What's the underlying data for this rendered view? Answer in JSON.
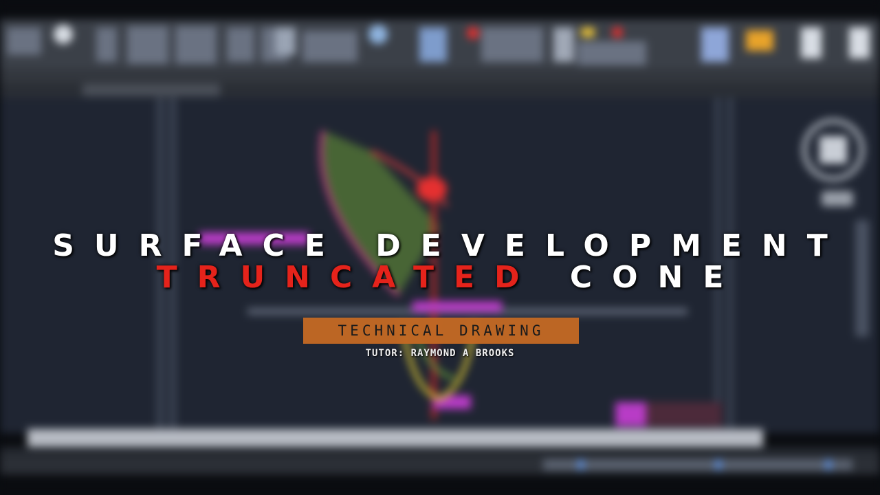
{
  "title": {
    "line1": "SURFACE DEVELOPMENT",
    "line2_red": "TRUNCATED",
    "line2_white": "CONE"
  },
  "tag": {
    "label": "TECHNICAL DRAWING"
  },
  "tutor": "TUTOR: RAYMOND A BROOKS",
  "colors": {
    "background": "#0a0c10",
    "drawing_area": "#1e2432",
    "ribbon": "#3a3f47",
    "accent_red": "#e5231b",
    "tag_orange": "#c56a24",
    "green_lines": "#7dbf3c",
    "magenta": "#c83cd2",
    "yellow": "#d6c233"
  },
  "icons": [
    "view-cube-icon",
    "navigation-bar-icon",
    "ribbon-tool-icon"
  ]
}
